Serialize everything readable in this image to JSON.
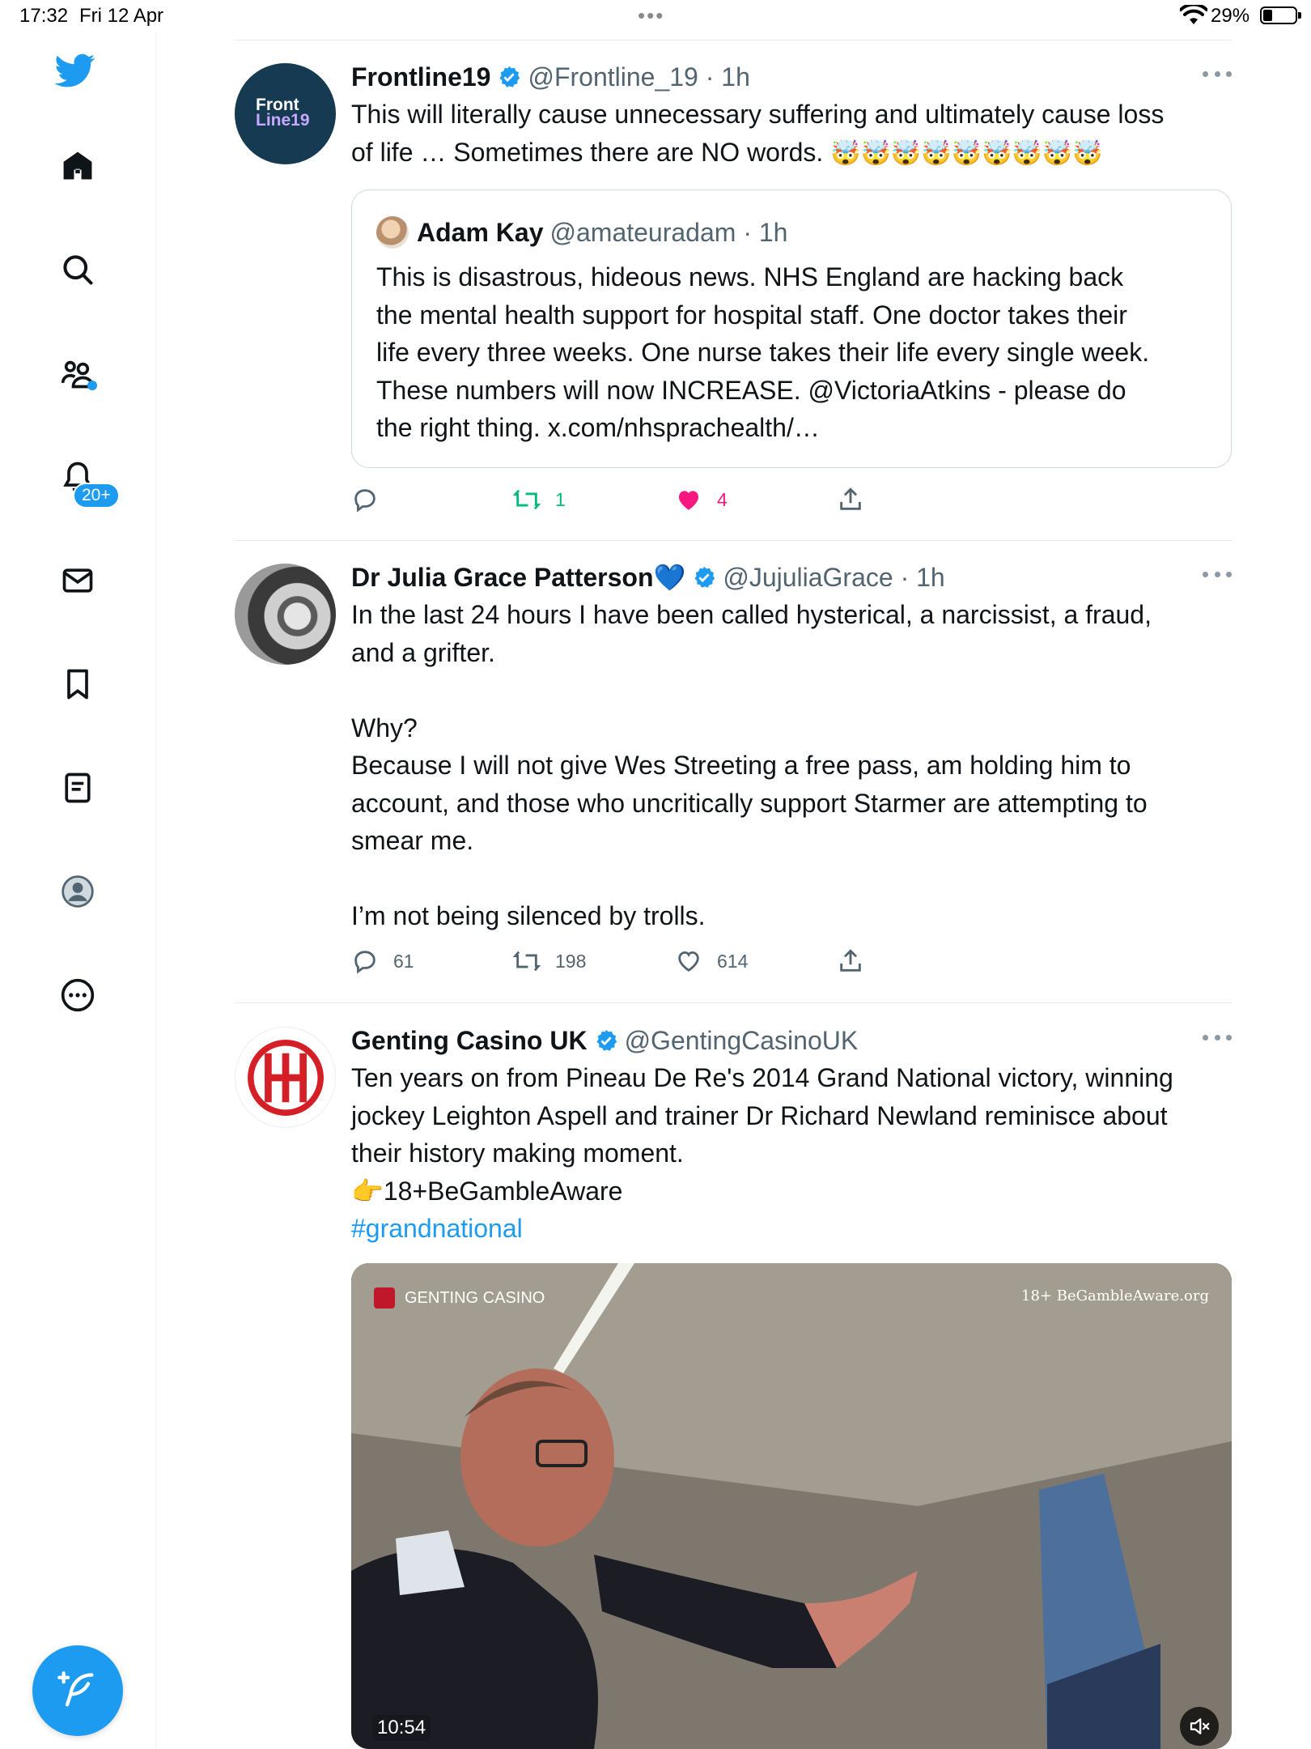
{
  "status_bar": {
    "time": "17:32",
    "date": "Fri 12 Apr",
    "battery_percent": "29%",
    "battery_level": 0.29
  },
  "sidebar": {
    "items": [
      {
        "name": "twitter-logo-icon"
      },
      {
        "name": "home-icon"
      },
      {
        "name": "search-icon"
      },
      {
        "name": "communities-icon"
      },
      {
        "name": "notifications-icon",
        "badge": "20+"
      },
      {
        "name": "messages-icon"
      },
      {
        "name": "bookmarks-icon"
      },
      {
        "name": "lists-icon"
      },
      {
        "name": "profile-icon"
      },
      {
        "name": "more-icon"
      }
    ],
    "compose_icon": "compose-feather-icon"
  },
  "tweets": [
    {
      "name": "Frontline19",
      "handle": "@Frontline_19",
      "time": "1h",
      "avatar_text": [
        "Front",
        "Line19"
      ],
      "text_line1": "This will literally cause unnecessary suffering and ultimately cause loss",
      "text_line2": "of life … Sometimes there are NO words. ",
      "emoji": "🤯🤯🤯🤯🤯🤯🤯🤯🤯",
      "quote": {
        "name": "Adam Kay",
        "handle": "@amateuradam",
        "time": "1h",
        "text": "This is disastrous, hideous news. NHS England are hacking back\nthe mental health support for hospital staff. One doctor takes their\nlife every three weeks. One nurse takes their life every single week.\nThese numbers will now INCREASE. @VictoriaAtkins - please do\nthe right thing. x.com/nhsprachealth/…"
      },
      "replies": "",
      "retweets": "1",
      "likes": "4"
    },
    {
      "name": "Dr Julia Grace Patterson",
      "name_emoji": "💙",
      "handle": "@JujuliaGrace",
      "time": "1h",
      "text": "In the last 24 hours I have been called hysterical, a narcissist, a fraud,\nand a grifter.\n\nWhy?\nBecause I will not give Wes Streeting a free pass, am holding him to\naccount, and those who uncritically support Starmer are attempting to\nsmear me.\n\nI’m not being silenced by trolls.",
      "replies": "61",
      "retweets": "198",
      "likes": "614"
    },
    {
      "name": "Genting Casino UK",
      "handle": "@GentingCasinoUK",
      "text": "Ten years on from Pineau De Re's 2014 Grand National victory, winning\njockey Leighton Aspell and trainer Dr Richard Newland reminisce about\ntheir history making moment.",
      "line_aware": "👉18+BeGambleAware",
      "hashtag": "#grandnational",
      "media": {
        "label_left": "GENTING CASINO",
        "label_right": "18+ BeGambleAware.org",
        "duration": "10:54"
      }
    }
  ],
  "colors": {
    "accent": "#1d9bf0",
    "retweet": "#00ba7c",
    "like": "#f91880",
    "secondary_text": "#536471"
  }
}
